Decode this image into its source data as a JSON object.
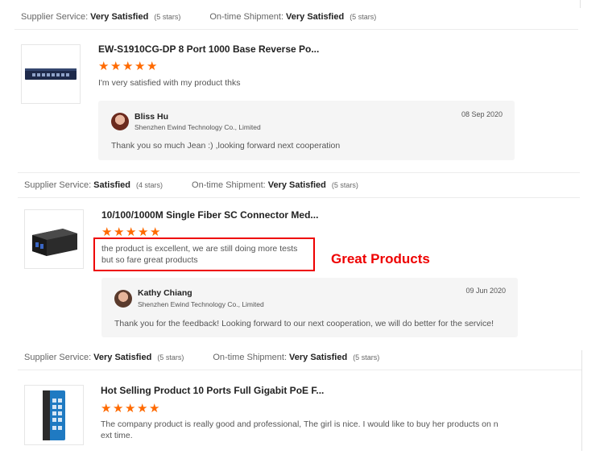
{
  "feedback": [
    {
      "supplier_service_label": "Supplier Service:",
      "supplier_service_value": "Very Satisfied",
      "supplier_service_stars": "(5 stars)",
      "shipment_label": "On-time Shipment:",
      "shipment_value": "Very Satisfied",
      "shipment_stars": "(5 stars)",
      "product_title": "EW-S1910CG-DP 8 Port 1000 Base Reverse Po...",
      "rating": 5,
      "review": "I'm very satisfied with my product thks",
      "reply": {
        "name": "Bliss Hu",
        "company": "Shenzhen Ewind Technology Co., Limited",
        "date": "08 Sep 2020",
        "text": "Thank you so much Jean :) ,looking forward next cooperation"
      }
    },
    {
      "supplier_service_label": "Supplier Service:",
      "supplier_service_value": "Satisfied",
      "supplier_service_stars": "(4 stars)",
      "shipment_label": "On-time Shipment:",
      "shipment_value": "Very Satisfied",
      "shipment_stars": "(5 stars)",
      "product_title": "10/100/1000M Single Fiber SC Connector Med...",
      "rating": 5,
      "review_line1": "the product is excellent, we are still doing more tests",
      "review_line2": "but so fare great products",
      "annotation": "Great Products",
      "reply": {
        "name": "Kathy Chiang",
        "company": "Shenzhen Ewind Technology Co., Limited",
        "date": "09 Jun 2020",
        "text": "Thank you for the feedback! Looking forward to our next cooperation, we will do better for the service!"
      }
    },
    {
      "supplier_service_label": "Supplier Service:",
      "supplier_service_value": "Very Satisfied",
      "supplier_service_stars": "(5 stars)",
      "shipment_label": "On-time Shipment:",
      "shipment_value": "Very Satisfied",
      "shipment_stars": "(5 stars)",
      "product_title": "Hot Selling Product 10 Ports Full Gigabit PoE F...",
      "rating": 5,
      "review_line1": "The company product is really good and professional,  The girl is nice. I would like to buy her products on n",
      "review_line2": "ext time."
    }
  ],
  "icons": {
    "star": "star-icon"
  },
  "colors": {
    "star": "#ff6a00",
    "annotation": "#e00000",
    "reply_bg": "#f5f5f5"
  }
}
